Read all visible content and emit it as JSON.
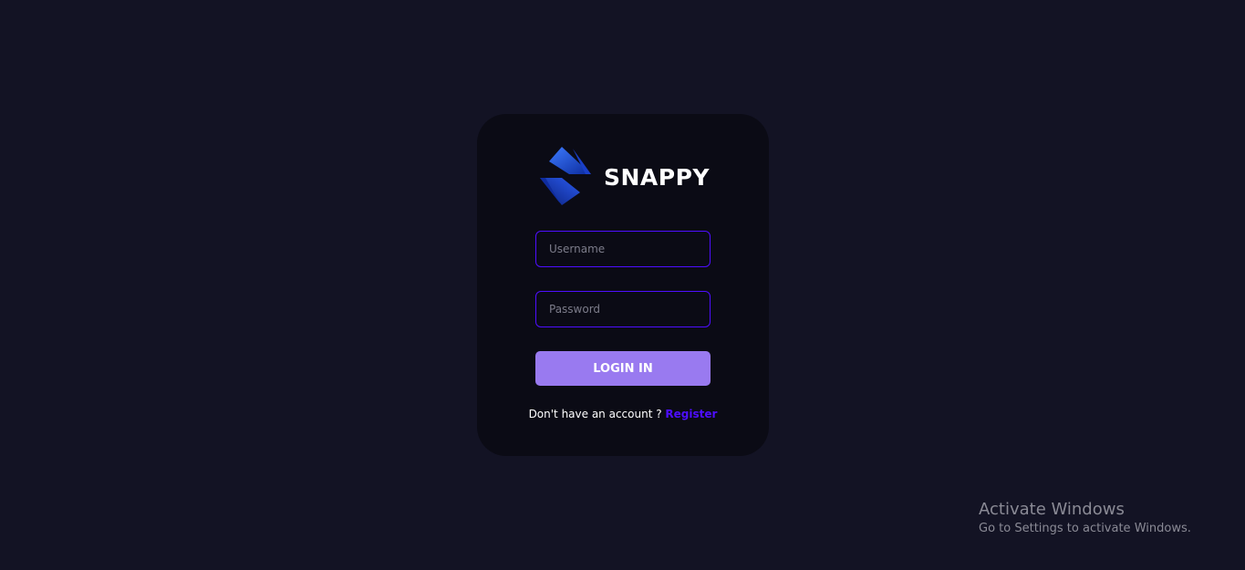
{
  "brand": {
    "name": "snappy",
    "logo_icon": "snappy-s-logo-icon"
  },
  "login_form": {
    "username_placeholder": "Username",
    "password_placeholder": "Password",
    "submit_label": "Login In",
    "register_prompt": "Don't have an account ? ",
    "register_link": "Register"
  },
  "watermark": {
    "title": "Activate Windows",
    "subtitle": "Go to Settings to activate Windows."
  },
  "colors": {
    "page_background": "#131324",
    "card_background": "#0b0b15",
    "accent": "#4e0eff",
    "button": "#997af0",
    "text": "#ffffff"
  }
}
